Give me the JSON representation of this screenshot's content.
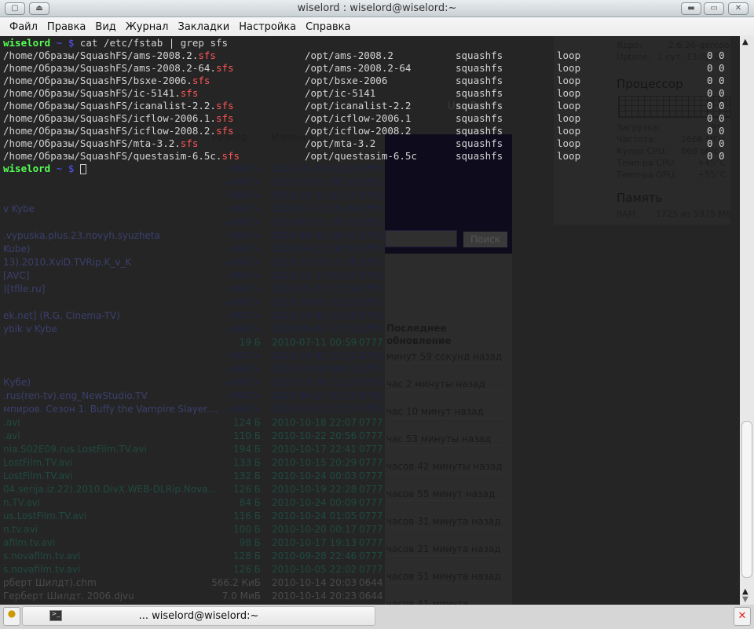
{
  "window": {
    "title": "wiselord : wiselord@wiselord:~"
  },
  "menu": [
    "Файл",
    "Правка",
    "Вид",
    "Журнал",
    "Закладки",
    "Настройка",
    "Справка"
  ],
  "terminal": {
    "prompt_user": "wiselord",
    "prompt_dir": "~",
    "prompt_sign": "$",
    "command": "cat /etc/fstab | grep sfs",
    "fstab": [
      {
        "src": "/home/Образы/SquashFS/ams-2008.2.",
        "ext": "sfs",
        "mnt": "/opt/ams-2008.2",
        "type": "squashfs",
        "opts": "loop",
        "dp": "0 0"
      },
      {
        "src": "/home/Образы/SquashFS/ams-2008.2-64.",
        "ext": "sfs",
        "mnt": "/opt/ams-2008.2-64",
        "type": "squashfs",
        "opts": "loop",
        "dp": "0 0"
      },
      {
        "src": "/home/Образы/SquashFS/bsxe-2006.",
        "ext": "sfs",
        "mnt": "/opt/bsxe-2006",
        "type": "squashfs",
        "opts": "loop",
        "dp": "0 0"
      },
      {
        "src": "/home/Образы/SquashFS/ic-5141.",
        "ext": "sfs",
        "mnt": "/opt/ic-5141",
        "type": "squashfs",
        "opts": "loop",
        "dp": "0 0"
      },
      {
        "src": "/home/Образы/SquashFS/icanalist-2.2.",
        "ext": "sfs",
        "mnt": "/opt/icanalist-2.2",
        "type": "squashfs",
        "opts": "loop",
        "dp": "0 0"
      },
      {
        "src": "/home/Образы/SquashFS/icflow-2006.1.",
        "ext": "sfs",
        "mnt": "/opt/icflow-2006.1",
        "type": "squashfs",
        "opts": "loop",
        "dp": "0 0"
      },
      {
        "src": "/home/Образы/SquashFS/icflow-2008.2.",
        "ext": "sfs",
        "mnt": "/opt/icflow-2008.2",
        "type": "squashfs",
        "opts": "loop",
        "dp": "0 0"
      },
      {
        "src": "/home/Образы/SquashFS/mta-3.2.",
        "ext": "sfs",
        "mnt": "/opt/mta-3.2",
        "type": "squashfs",
        "opts": "loop",
        "dp": "0 0"
      },
      {
        "src": "/home/Образы/SquashFS/questasim-6.5c.",
        "ext": "sfs",
        "mnt": "/opt/questasim-6.5c",
        "type": "squashfs",
        "opts": "loop",
        "dp": "0 0"
      }
    ]
  },
  "file_manager": {
    "headers": {
      "size": "Размер",
      "modified": "Изменён"
    },
    "rows": [
      {
        "name": "",
        "size": "<КАТ>",
        "date": "2010-10-24 01:03",
        "perm": "0755",
        "kind": "dir"
      },
      {
        "name": "",
        "size": "<КАТ>",
        "date": "2010-10-21 09:50",
        "perm": "0755",
        "kind": "dir"
      },
      {
        "name": "",
        "size": "<КАТ>",
        "date": "2010-10-21 07:22",
        "perm": "0755",
        "kind": "dir"
      },
      {
        "name": "v Kybe",
        "size": "<КАТ>",
        "date": "2010-07-11 00:49",
        "perm": "0755",
        "kind": "dir"
      },
      {
        "name": "",
        "size": "<КАТ>",
        "date": "2010-07-11 10:02",
        "perm": "0755",
        "kind": "dir"
      },
      {
        "name": ".vypuska.plus.23.novyh.syuzheta",
        "size": "<КАТ>",
        "date": "2010-09-05 10:42",
        "perm": "0755",
        "kind": "dir"
      },
      {
        "name": "Kube)",
        "size": "<КАТ>",
        "date": "2010-09-13 18:55",
        "perm": "0755",
        "kind": "dir"
      },
      {
        "name": "13).2010.XviD.TVRip.K_v_K",
        "size": "<КАТ>",
        "date": "2010-10-19 17:28",
        "perm": "0755",
        "kind": "dir"
      },
      {
        "name": "[AVC]",
        "size": "<КАТ>",
        "date": "2010-10-23 01:07",
        "perm": "0755",
        "kind": "dir"
      },
      {
        "name": ")[tfile.ru]",
        "size": "<КАТ>",
        "date": "2010-10-23 11:59",
        "perm": "0755",
        "kind": "dir"
      },
      {
        "name": "",
        "size": "<КАТ>",
        "date": "2010-10-05 02:10",
        "perm": "0755",
        "kind": "dir"
      },
      {
        "name": "ek.net] (R.G. Cinema-TV)",
        "size": "<КАТ>",
        "date": "2010-10-02 21:15",
        "perm": "0755",
        "kind": "dir"
      },
      {
        "name": "ybik v Kybe",
        "size": "<КАТ>",
        "date": "2010-09-04 17:01",
        "perm": "0755",
        "kind": "dir"
      },
      {
        "name": "",
        "size": "19 Б",
        "date": "2010-07-11 00:59",
        "perm": "0777",
        "kind": "file"
      },
      {
        "name": "",
        "size": "<КАТ>",
        "date": "2010-10-02 21:12",
        "perm": "0755",
        "kind": "dir"
      },
      {
        "name": "",
        "size": "<КАТ>",
        "date": "2010-10-08 08:01",
        "perm": "0755",
        "kind": "dir"
      },
      {
        "name": "Кубе)",
        "size": "<КАТ>",
        "date": "2010-10-20 21:23",
        "perm": "0755",
        "kind": "dir"
      },
      {
        "name": ".rus(ren-tv).eng_NewStudio.TV",
        "size": "<КАТ>",
        "date": "2010-09-17 01:23",
        "perm": "0755",
        "kind": "dir"
      },
      {
        "name": "мпиров. Сезон 1.  Buffy the Vampire Slayer....",
        "size": "<КАТ>",
        "date": "2010-10-12 22:37",
        "perm": "0755",
        "kind": "dir"
      },
      {
        "name": ".avi",
        "size": "124 Б",
        "date": "2010-10-18 22:07",
        "perm": "0777",
        "kind": "file"
      },
      {
        "name": ".avi",
        "size": "110 Б",
        "date": "2010-10-22 20:56",
        "perm": "0777",
        "kind": "file"
      },
      {
        "name": "nia.S02E09.rus.LostFilm.TV.avi",
        "size": "194 Б",
        "date": "2010-10-17 22:41",
        "perm": "0777",
        "kind": "file"
      },
      {
        "name": "LostFilm.TV.avi",
        "size": "133 Б",
        "date": "2010-10-15 20:29",
        "perm": "0777",
        "kind": "file"
      },
      {
        "name": "LostFilm.TV.avi",
        "size": "132 Б",
        "date": "2010-10-24 00:03",
        "perm": "0777",
        "kind": "file"
      },
      {
        "name": "04.serija.iz.22).2010.DivX.WEB-DLRip.Nova...",
        "size": "126 Б",
        "date": "2010-10-19 22:28",
        "perm": "0777",
        "kind": "file"
      },
      {
        "name": "n.TV.avi",
        "size": "84 Б",
        "date": "2010-10-24 00:09",
        "perm": "0777",
        "kind": "file"
      },
      {
        "name": "us.LostFilm.TV.avi",
        "size": "116 Б",
        "date": "2010-10-24 01:05",
        "perm": "0777",
        "kind": "file"
      },
      {
        "name": "n.tv.avi",
        "size": "100 Б",
        "date": "2010-10-20 00:17",
        "perm": "0777",
        "kind": "file"
      },
      {
        "name": "afilm.tv.avi",
        "size": "98 Б",
        "date": "2010-10-17 19:13",
        "perm": "0777",
        "kind": "file"
      },
      {
        "name": "s.novafilm.tv.avi",
        "size": "128 Б",
        "date": "2010-09-28 22:46",
        "perm": "0777",
        "kind": "file"
      },
      {
        "name": "s.novafilm.tv.avi",
        "size": "126 Б",
        "date": "2010-10-05 22:02",
        "perm": "0777",
        "kind": "file"
      },
      {
        "name": "рберт Шилдт).chm",
        "size": "566.2 КиБ",
        "date": "2010-10-14 20:03",
        "perm": "0644",
        "kind": "doc"
      },
      {
        "name": "Герберт Шилдт. 2006.djvu",
        "size": "7.0 МиБ",
        "date": "2010-10-14 20:23",
        "perm": "0644",
        "kind": "doc"
      }
    ]
  },
  "browser": {
    "search_button": "Поиск",
    "tab_label": "UnixFor",
    "update_header": "Последнее обновление",
    "updates": [
      "минут 59 секунд назад",
      "час 2 минуты назад",
      "час 10 минут назад",
      "час 53 минуты назад",
      "часов 42 минуты назад",
      "часов 55 минут назад",
      "часов 31 минута назад",
      "часов 21 минута назад",
      "часов 51 минута назад",
      "часов 41 минута"
    ]
  },
  "sysmon": {
    "kernel_label": "Ядро:",
    "kernel": "2.6.36-gentoo",
    "uptime_label": "Uptime:",
    "uptime": "1 сут.  13:02:03",
    "cpu_title": "Процессор",
    "load_label": "Загрузка:",
    "load": "9%",
    "freq_label": "Частота:",
    "freq": "2666 МГц",
    "fan_label": "Кулер CPU:",
    "fan": "868 об/с",
    "tcpu_label": "Темп-ра CPU:",
    "tcpu": "+45°C",
    "tgpu_label": "Темп-ра GPU:",
    "tgpu": "+55°C",
    "mem_title": "Память",
    "ram_label": "RAM:",
    "ram": "1725 из 5975 Мб"
  },
  "taskbar": {
    "task_label": "... wiselord@wiselord:~"
  }
}
